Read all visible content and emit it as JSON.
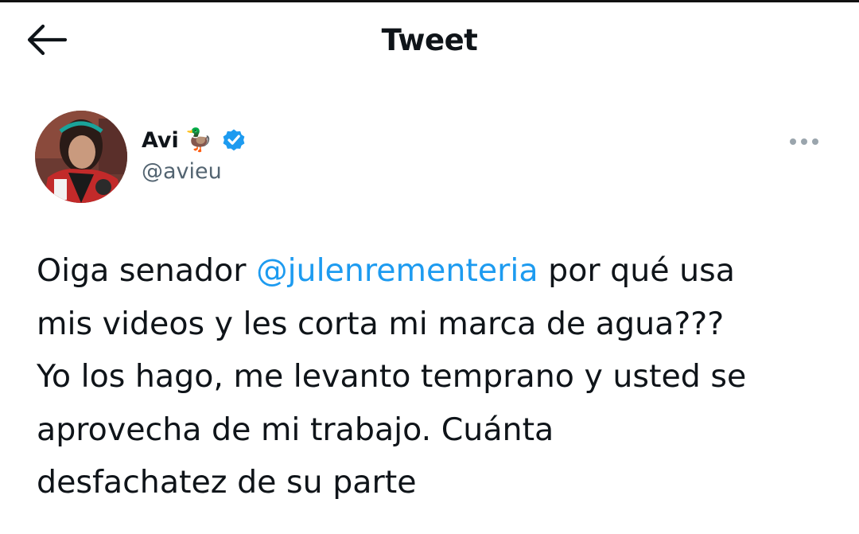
{
  "header": {
    "title": "Tweet",
    "back_icon": "arrow-left-icon"
  },
  "author": {
    "display_name": "Avi",
    "emoji": "🦆",
    "handle": "@avieu",
    "verified": true,
    "verified_color": "#1d9bf0"
  },
  "menu": {
    "icon": "more-horizontal-icon"
  },
  "tweet": {
    "lines": [
      {
        "pre": "Oiga senador ",
        "mention": "@julenrementeria",
        "post": " por qué usa"
      },
      {
        "text": "mis videos y les corta mi marca de agua???"
      },
      {
        "text": "Yo los hago, me levanto temprano y usted se"
      },
      {
        "text": "aprovecha de mi trabajo. Cuánta"
      },
      {
        "text": "desfachatez de su parte"
      }
    ]
  },
  "colors": {
    "text": "#0f1419",
    "secondary": "#536471",
    "accent": "#1d9bf0"
  }
}
